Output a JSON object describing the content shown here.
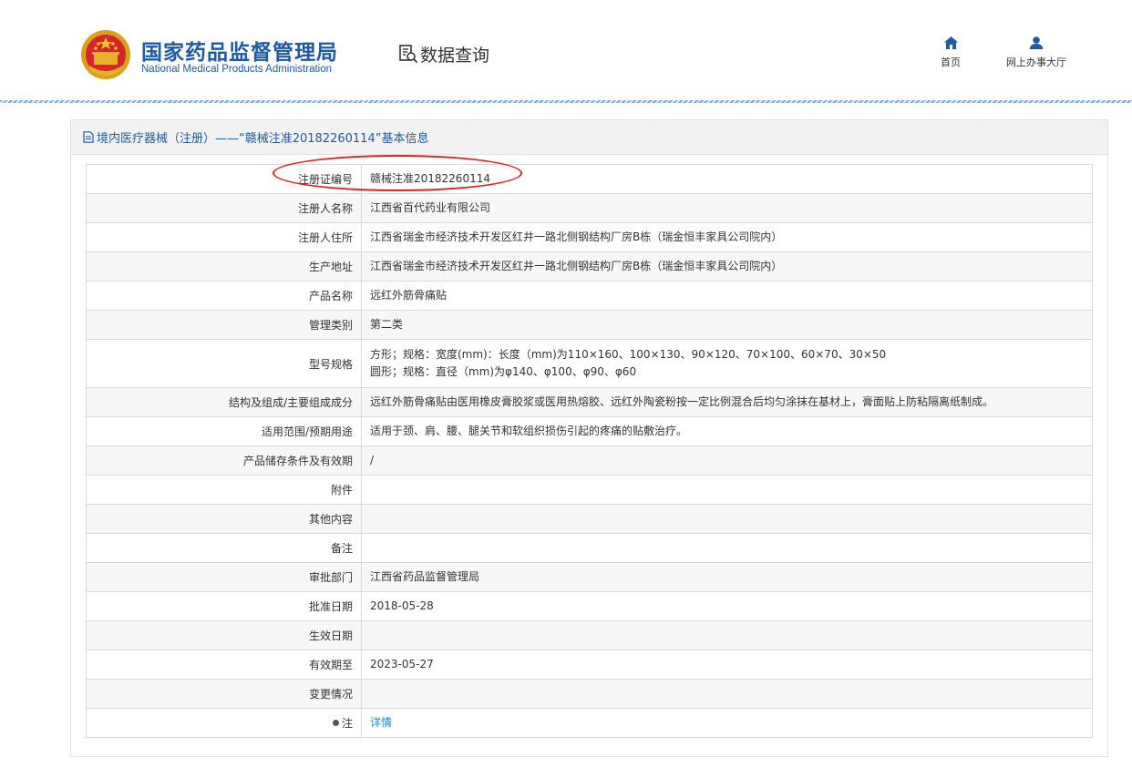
{
  "header": {
    "logo_cn": "国家药品监督管理局",
    "logo_en": "National Medical Products Administration",
    "query_label": "数据查询",
    "nav": [
      {
        "label": "首页",
        "icon": "home-icon"
      },
      {
        "label": "网上办事大厅",
        "icon": "user-icon"
      }
    ]
  },
  "panel": {
    "title": "境内医疗器械（注册）——“赣械注准20182260114”基本信息",
    "rows": [
      {
        "key": "注册证编号",
        "lines": [
          "赣械注准20182260114"
        ]
      },
      {
        "key": "注册人名称",
        "lines": [
          "江西省百代药业有限公司"
        ]
      },
      {
        "key": "注册人住所",
        "lines": [
          "江西省瑞金市经济技术开发区红井一路北侧钢结构厂房B栋（瑞金恒丰家具公司院内）"
        ]
      },
      {
        "key": "生产地址",
        "lines": [
          "江西省瑞金市经济技术开发区红井一路北侧钢结构厂房B栋（瑞金恒丰家具公司院内）"
        ]
      },
      {
        "key": "产品名称",
        "lines": [
          "远红外筋骨痛贴"
        ]
      },
      {
        "key": "管理类别",
        "lines": [
          "第二类"
        ]
      },
      {
        "key": "型号规格",
        "lines": [
          "方形；规格：宽度(mm)：长度（mm)为110×160、100×130、90×120、70×100、60×70、30×50",
          "圆形；规格：直径（mm)为φ140、φ100、φ90、φ60"
        ]
      },
      {
        "key": "结构及组成/主要组成成分",
        "lines": [
          "远红外筋骨痛贴由医用橡皮膏胶浆或医用热熔胶、远红外陶瓷粉按一定比例混合后均匀涂抹在基材上，膏面贴上防粘隔离纸制成。"
        ]
      },
      {
        "key": "适用范围/预期用途",
        "lines": [
          "适用于颈、肩、腰、腿关节和软组织损伤引起的疼痛的贴敷治疗。"
        ]
      },
      {
        "key": "产品储存条件及有效期",
        "lines": [
          "/"
        ]
      },
      {
        "key": "附件",
        "lines": [
          ""
        ]
      },
      {
        "key": "其他内容",
        "lines": [
          ""
        ]
      },
      {
        "key": "备注",
        "lines": [
          ""
        ]
      },
      {
        "key": "审批部门",
        "lines": [
          "江西省药品监督管理局"
        ]
      },
      {
        "key": "批准日期",
        "lines": [
          "2018-05-28"
        ]
      },
      {
        "key": "生效日期",
        "lines": [
          ""
        ]
      },
      {
        "key": "有效期至",
        "lines": [
          "2023-05-27"
        ]
      },
      {
        "key": "变更情况",
        "lines": [
          ""
        ]
      },
      {
        "key": "注",
        "lines": [
          "详情"
        ]
      }
    ]
  },
  "colors": {
    "brand_blue": "#1e5aa6",
    "link_blue": "#1e88d8",
    "highlight_red": "#e02020"
  }
}
